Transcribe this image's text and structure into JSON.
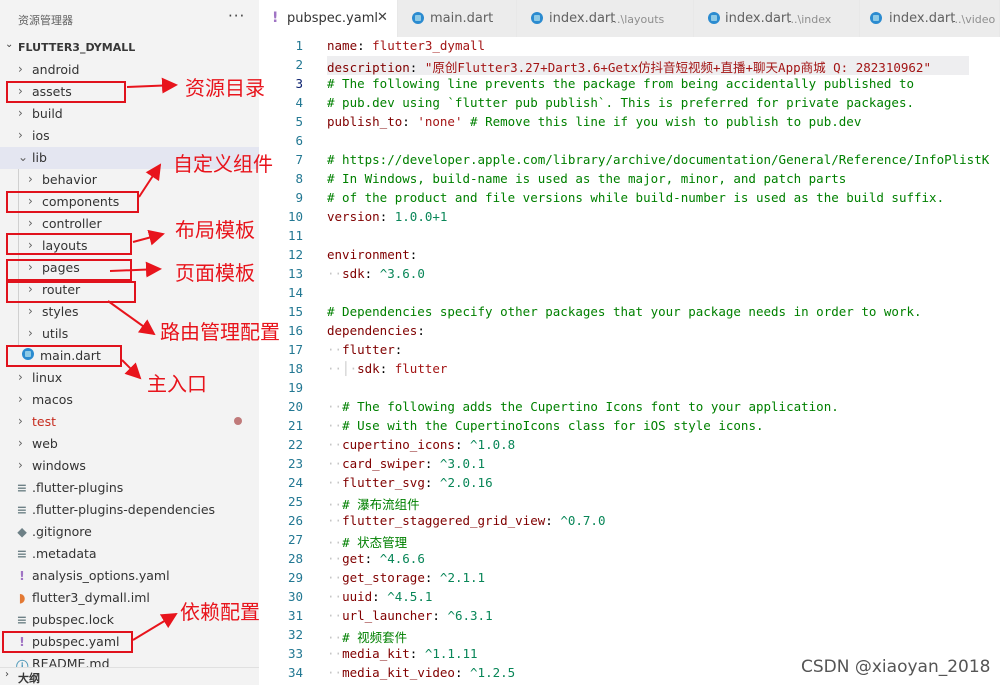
{
  "explorer": {
    "title": "资源管理器",
    "more": "···",
    "workspace": "FLUTTER3_DYMALL",
    "items": [
      {
        "label": "android"
      },
      {
        "label": "assets"
      },
      {
        "label": "build"
      },
      {
        "label": "ios"
      },
      {
        "label": "lib"
      },
      {
        "label": "behavior"
      },
      {
        "label": "components"
      },
      {
        "label": "controller"
      },
      {
        "label": "layouts"
      },
      {
        "label": "pages"
      },
      {
        "label": "router"
      },
      {
        "label": "styles"
      },
      {
        "label": "utils"
      },
      {
        "label": "main.dart",
        "icon": "dart-icon"
      },
      {
        "label": "linux"
      },
      {
        "label": "macos"
      },
      {
        "label": "test"
      },
      {
        "label": "web"
      },
      {
        "label": "windows"
      },
      {
        "label": ".flutter-plugins",
        "icon": "lines-icon"
      },
      {
        "label": ".flutter-plugins-dependencies",
        "icon": "lines-icon"
      },
      {
        "label": ".gitignore",
        "icon": "git-icon"
      },
      {
        "label": ".metadata",
        "icon": "lines-icon"
      },
      {
        "label": "analysis_options.yaml",
        "icon": "yaml-icon"
      },
      {
        "label": "flutter3_dymall.iml",
        "icon": "rss-icon"
      },
      {
        "label": "pubspec.lock",
        "icon": "lines-icon"
      },
      {
        "label": "pubspec.yaml",
        "icon": "yaml-icon"
      },
      {
        "label": "README.md",
        "icon": "info-icon"
      }
    ],
    "outline": "大纲"
  },
  "tabs": [
    {
      "name": "pubspec.yaml",
      "desc": "",
      "icon": "yaml-icon",
      "active": true
    },
    {
      "name": "main.dart",
      "desc": "",
      "icon": "dart-icon"
    },
    {
      "name": "index.dart",
      "desc": "...\\layouts",
      "icon": "dart-icon"
    },
    {
      "name": "index.dart",
      "desc": "...\\index",
      "icon": "dart-icon"
    },
    {
      "name": "index.dart",
      "desc": "...\\video",
      "icon": "dart-icon"
    }
  ],
  "tab_close": "✕",
  "editor": {
    "current_line": 3,
    "lines": [
      [
        [
          "k",
          "name"
        ],
        [
          "p",
          ": "
        ],
        [
          "s",
          "flutter3_dymall"
        ]
      ],
      [
        [
          "k",
          "description"
        ],
        [
          "p",
          ": "
        ],
        [
          "s",
          "\"原创Flutter3.27+Dart3.6+Getx仿抖音短视频+直播+聊天App商城 Q: 282310962\""
        ]
      ],
      [
        [
          "c",
          "# The following line prevents the package from being accidentally published to"
        ]
      ],
      [
        [
          "c",
          "# pub.dev using `flutter pub publish`. This is preferred for private packages."
        ]
      ],
      [
        [
          "k",
          "publish_to"
        ],
        [
          "p",
          ": "
        ],
        [
          "s",
          "'none'"
        ],
        [
          "p",
          " "
        ],
        [
          "c",
          "# Remove this line if you wish to publish to pub.dev"
        ]
      ],
      [],
      [
        [
          "c",
          "# https://developer.apple.com/library/archive/documentation/General/Reference/InfoPlistK"
        ]
      ],
      [
        [
          "c",
          "# In Windows, build-name is used as the major, minor, and patch parts"
        ]
      ],
      [
        [
          "c",
          "# of the product and file versions while build-number is used as the build suffix."
        ]
      ],
      [
        [
          "k",
          "version"
        ],
        [
          "p",
          ": "
        ],
        [
          "n",
          "1.0.0+1"
        ]
      ],
      [],
      [
        [
          "k",
          "environment"
        ],
        [
          "p",
          ":"
        ]
      ],
      [
        [
          "ws",
          "··"
        ],
        [
          "k",
          "sdk"
        ],
        [
          "p",
          ": "
        ],
        [
          "n",
          "^3.6.0"
        ]
      ],
      [],
      [
        [
          "c",
          "# Dependencies specify other packages that your package needs in order to work."
        ]
      ],
      [
        [
          "k",
          "dependencies"
        ],
        [
          "p",
          ":"
        ]
      ],
      [
        [
          "ws",
          "··"
        ],
        [
          "k",
          "flutter"
        ],
        [
          "p",
          ":"
        ]
      ],
      [
        [
          "ws",
          "··│·"
        ],
        [
          "k",
          "sdk"
        ],
        [
          "p",
          ": "
        ],
        [
          "s",
          "flutter"
        ]
      ],
      [],
      [
        [
          "ws",
          "··"
        ],
        [
          "c",
          "# The following adds the Cupertino Icons font to your application."
        ]
      ],
      [
        [
          "ws",
          "··"
        ],
        [
          "c",
          "# Use with the CupertinoIcons class for iOS style icons."
        ]
      ],
      [
        [
          "ws",
          "··"
        ],
        [
          "k",
          "cupertino_icons"
        ],
        [
          "p",
          ": "
        ],
        [
          "n",
          "^1.0.8"
        ]
      ],
      [
        [
          "ws",
          "··"
        ],
        [
          "k",
          "card_swiper"
        ],
        [
          "p",
          ": "
        ],
        [
          "n",
          "^3.0.1"
        ]
      ],
      [
        [
          "ws",
          "··"
        ],
        [
          "k",
          "flutter_svg"
        ],
        [
          "p",
          ": "
        ],
        [
          "n",
          "^2.0.16"
        ]
      ],
      [
        [
          "ws",
          "··"
        ],
        [
          "c",
          "# 瀑布流组件"
        ]
      ],
      [
        [
          "ws",
          "··"
        ],
        [
          "k",
          "flutter_staggered_grid_view"
        ],
        [
          "p",
          ": "
        ],
        [
          "n",
          "^0.7.0"
        ]
      ],
      [
        [
          "ws",
          "··"
        ],
        [
          "c",
          "# 状态管理"
        ]
      ],
      [
        [
          "ws",
          "··"
        ],
        [
          "k",
          "get"
        ],
        [
          "p",
          ": "
        ],
        [
          "n",
          "^4.6.6"
        ]
      ],
      [
        [
          "ws",
          "··"
        ],
        [
          "k",
          "get_storage"
        ],
        [
          "p",
          ": "
        ],
        [
          "n",
          "^2.1.1"
        ]
      ],
      [
        [
          "ws",
          "··"
        ],
        [
          "k",
          "uuid"
        ],
        [
          "p",
          ": "
        ],
        [
          "n",
          "^4.5.1"
        ]
      ],
      [
        [
          "ws",
          "··"
        ],
        [
          "k",
          "url_launcher"
        ],
        [
          "p",
          ": "
        ],
        [
          "n",
          "^6.3.1"
        ]
      ],
      [
        [
          "ws",
          "··"
        ],
        [
          "c",
          "# 视频套件"
        ]
      ],
      [
        [
          "ws",
          "··"
        ],
        [
          "k",
          "media_kit"
        ],
        [
          "p",
          ": "
        ],
        [
          "n",
          "^1.1.11"
        ]
      ],
      [
        [
          "ws",
          "··"
        ],
        [
          "k",
          "media_kit_video"
        ],
        [
          "p",
          ": "
        ],
        [
          "n",
          "^1.2.5"
        ]
      ]
    ]
  },
  "annotations": [
    {
      "text": "资源目录"
    },
    {
      "text": "自定义组件"
    },
    {
      "text": "布局模板"
    },
    {
      "text": "页面模板"
    },
    {
      "text": "路由管理配置"
    },
    {
      "text": "主入口"
    },
    {
      "text": "依赖配置"
    }
  ],
  "watermark": "CSDN @xiaoyan_2018",
  "colors": {
    "annotation": "#e8141c",
    "keyword": "#800000",
    "string": "#a31515",
    "comment": "#008000",
    "number": "#098658"
  }
}
